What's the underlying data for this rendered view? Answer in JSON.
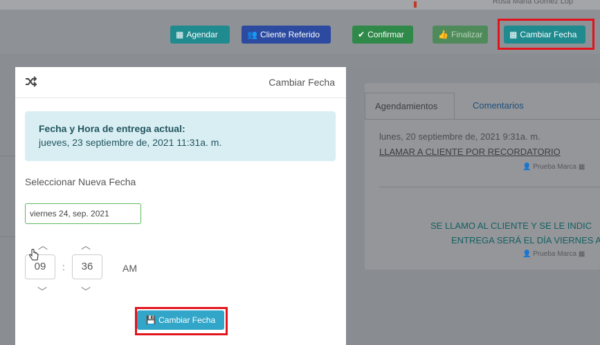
{
  "header": {
    "user_text": "Rosa Maria Gomez Lop"
  },
  "toolbar": {
    "agendar_label": "Agendar",
    "cliente_referido_label": "Cliente Referido",
    "confirmar_label": "Confirmar",
    "finalizar_label": "Finalizar",
    "cambiar_fecha_label": "Cambiar Fecha"
  },
  "tabs": {
    "agendamientos": "Agendamientos",
    "comentarios": "Comentarios"
  },
  "entry": {
    "date": "lunes, 20 septiembre de, 2021 9:31a. m.",
    "link": "LLAMAR A CLIENTE POR RECORDATORIO",
    "meta": "Prueba Marca",
    "note_line1": "SE LLAMO AL CLIENTE Y SE LE INDIC",
    "note_line2": "ENTREGA SERÁ EL DÍA VIERNES A",
    "meta2": "Prueba Marca"
  },
  "modal": {
    "title": "Cambiar Fecha",
    "alert_title": "Fecha y Hora de entrega actual:",
    "alert_value": "jueves, 23 septiembre de, 2021 11:31a. m.",
    "select_label": "Seleccionar Nueva Fecha",
    "date_value": "viernes 24, sep. 2021",
    "hour": "09",
    "minute": "36",
    "ampm": "AM",
    "submit_label": "Cambiar Fecha"
  },
  "colors": {
    "accent_red": "#e3131b",
    "info": "#31a6c8",
    "success": "#5cb85c"
  }
}
